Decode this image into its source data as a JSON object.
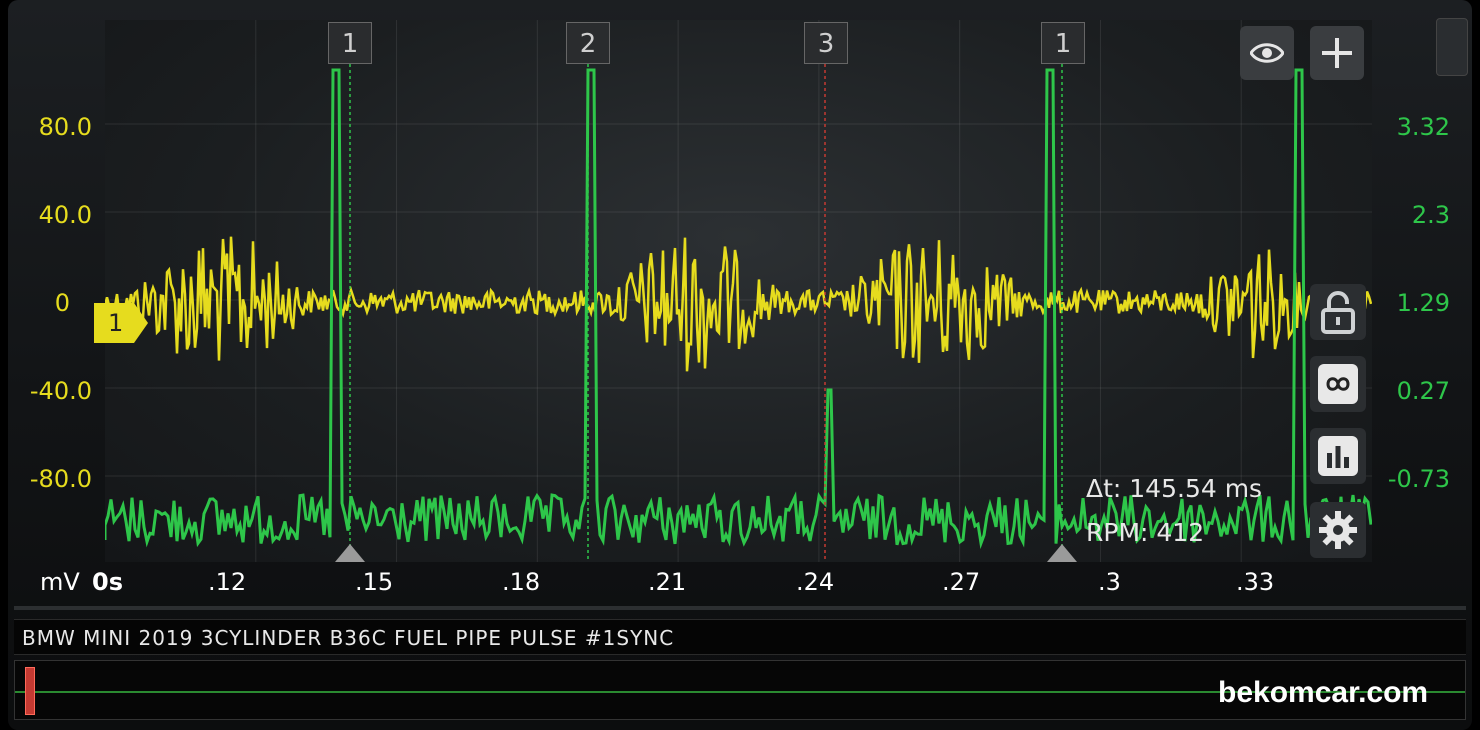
{
  "app": {
    "capture_title": "BMW MINI 2019 3CYLINDER B36C FUEL PIPE PULSE #1SYNC",
    "watermark": "bekomcar.com"
  },
  "scope": {
    "left_axis": {
      "unit": "mV",
      "ticks": [
        "80.0",
        "40.0",
        "0",
        "-40.0",
        "-80.0"
      ],
      "color": "#e6dc1e"
    },
    "right_axis": {
      "ticks": [
        "3.32",
        "2.3",
        "1.29",
        "0.27",
        "-0.73"
      ],
      "color": "#2ec64a"
    },
    "x_axis": {
      "ticks": [
        "0s",
        ".12",
        ".15",
        ".18",
        ".21",
        ".24",
        ".27",
        ".3",
        ".33"
      ]
    },
    "cursors": [
      "1",
      "2",
      "3",
      "1"
    ],
    "trigger_channel": "1",
    "readouts": {
      "delta_t": "Δt: 145.54 ms",
      "rpm": "RPM: 412"
    }
  },
  "toolbar": {
    "icons": [
      "eye-icon",
      "plus-icon",
      "lock-open-icon",
      "infinity-icon",
      "bar-chart-icon",
      "gear-icon"
    ]
  },
  "colors": {
    "channel_a": "#e6dc1e",
    "channel_b": "#2ec64a",
    "cursor_line": "#c43a32"
  }
}
